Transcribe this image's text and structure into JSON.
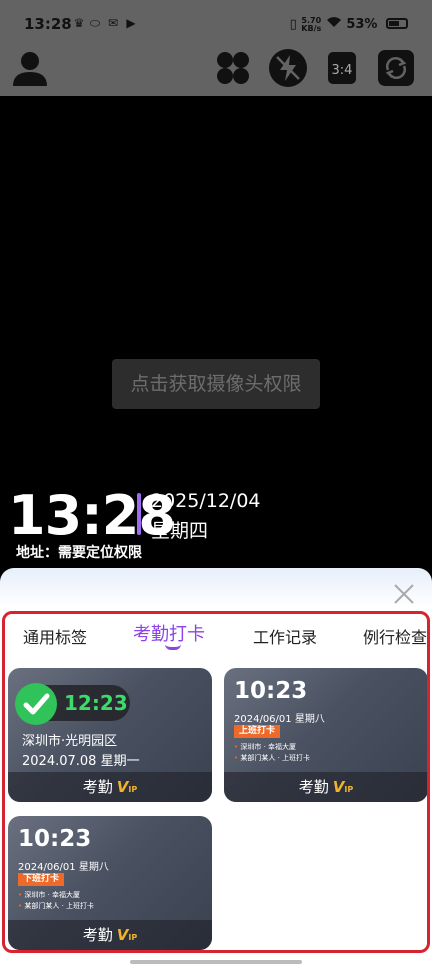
{
  "status_bar": {
    "time": "13:28",
    "net_speed_value": "5.70",
    "net_speed_unit": "KB/s",
    "battery": "53%"
  },
  "camera": {
    "permission_button": "点击获取摄像头权限"
  },
  "watermark": {
    "time": "13:28",
    "date": "2025/12/04",
    "weekday": "星期四",
    "address": "地址：需要定位权限",
    "accent_color": "#9b6bf0"
  },
  "tabs": [
    {
      "label": "通用标签",
      "active": false
    },
    {
      "label": "考勤打卡",
      "active": true
    },
    {
      "label": "工作记录",
      "active": false
    },
    {
      "label": "例行检查",
      "active": false
    }
  ],
  "accent": "#8d43e8",
  "cards": [
    {
      "time": "12:23",
      "place": "深圳市·光明园区",
      "date": "2024.07.08  星期一",
      "footer": "考勤",
      "vip": "V",
      "vip_small": "IP"
    },
    {
      "time": "10:23",
      "date": "2024/06/01  星期八",
      "badge": "上班打卡",
      "line1": "深圳市 · 幸福大厦",
      "line2": "某部门某人 · 上班打卡",
      "footer": "考勤",
      "vip": "V",
      "vip_small": "IP"
    },
    {
      "time": "10:23",
      "date": "2024/06/01  星期八",
      "badge": "下班打卡",
      "line1": "深圳市 · 幸福大厦",
      "line2": "某部门某人 · 上班打卡",
      "footer": "考勤",
      "vip": "V",
      "vip_small": "IP"
    }
  ]
}
